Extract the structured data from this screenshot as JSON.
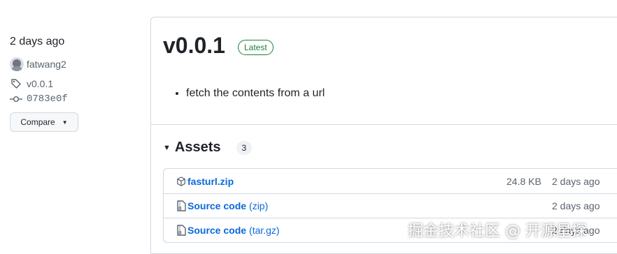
{
  "sidebar": {
    "date": "2 days ago",
    "author": "fatwang2",
    "tag": "v0.0.1",
    "commit": "0783e0f",
    "compare_label": "Compare"
  },
  "release": {
    "version": "v0.0.1",
    "badge": "Latest",
    "notes": [
      "fetch the contents from a url"
    ]
  },
  "assets": {
    "title": "Assets",
    "count": "3",
    "items": [
      {
        "name": "fasturl.zip",
        "ext": "",
        "size": "24.8 KB",
        "date": "2 days ago",
        "icon": "package-icon"
      },
      {
        "name": "Source code",
        "ext": "(zip)",
        "size": "",
        "date": "2 days ago",
        "icon": "file-zip-icon"
      },
      {
        "name": "Source code",
        "ext": "(tar.gz)",
        "size": "",
        "date": "2 days ago",
        "icon": "file-zip-icon"
      }
    ]
  },
  "watermark": "掘金技术社区 @ 开源星探",
  "colors": {
    "link": "#0969da",
    "latest_green": "#1a7f37",
    "border": "#d1d9e0",
    "muted": "#59636e"
  }
}
